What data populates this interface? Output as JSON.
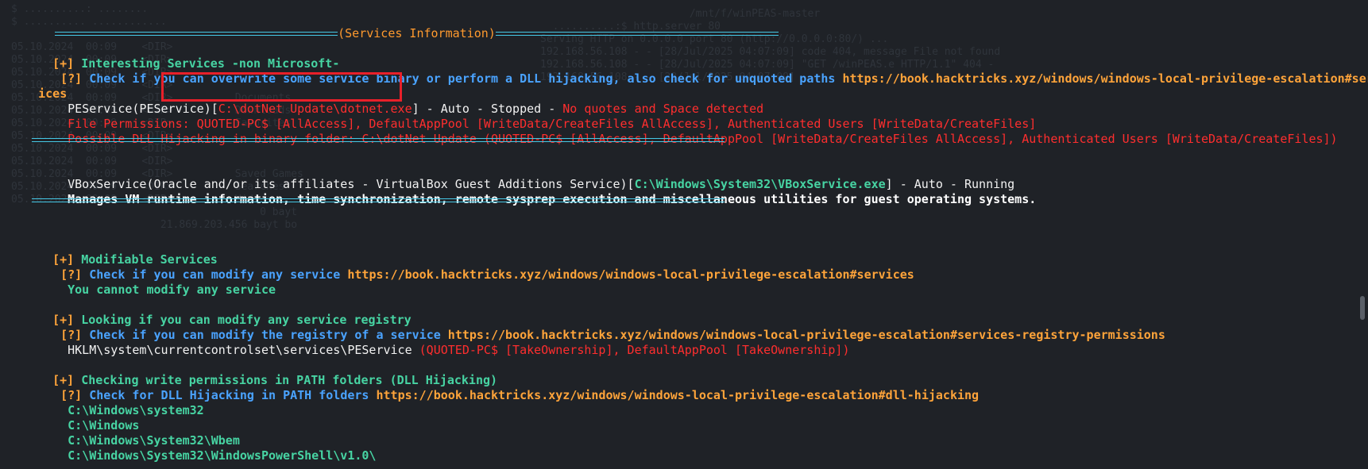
{
  "header": {
    "title": "(Services Information)"
  },
  "sections": {
    "interesting": {
      "heading_marker": "[+]",
      "heading": "Interesting Services -non Microsoft-",
      "check_marker": "[?]",
      "check_text": "Check if you can overwrite some service binary or perform a DLL hijacking, also check for unquoted paths",
      "check_url": "https://book.hacktricks.xyz/windows/windows-local-privilege-escalation#serv",
      "check_url_wrap": "ices",
      "pe_service": {
        "name": "PEService(PEService)[",
        "path": "C:\\dotNet Update\\dotnet.exe",
        "status": "] - Auto - Stopped - ",
        "warning": "No quotes and Space detected",
        "file_perms": "File Permissions: QUOTED-PC$ [AllAccess], DefaultAppPool [WriteData/CreateFiles AllAccess], Authenticated Users [WriteData/CreateFiles]",
        "dll_hijack": "Possible DLL Hijacking in binary folder: C:\\dotNet Update (QUOTED-PC$ [AllAccess], DefaultAppPool [WriteData/CreateFiles AllAccess], Authenticated Users [WriteData/CreateFiles])"
      },
      "vbox_service": {
        "name": "VBoxService(Oracle and/or its affiliates - VirtualBox Guest Additions Service)[",
        "path": "C:\\Windows\\System32\\VBoxService.exe",
        "status": "] - Auto - Running",
        "description": "Manages VM runtime information, time synchronization, remote sysprep execution and miscellaneous utilities for guest operating systems."
      }
    },
    "modifiable": {
      "heading_marker": "[+]",
      "heading": "Modifiable Services",
      "check_marker": "[?]",
      "check_text": "Check if you can modify any service",
      "check_url": "https://book.hacktricks.xyz/windows/windows-local-privilege-escalation#services",
      "result": "You cannot modify any service"
    },
    "registry": {
      "heading_marker": "[+]",
      "heading": "Looking if you can modify any service registry",
      "check_marker": "[?]",
      "check_text": "Check if you can modify the registry of a service",
      "check_url": "https://book.hacktricks.xyz/windows/windows-local-privilege-escalation#services-registry-permissions",
      "key": "HKLM\\system\\currentcontrolset\\services\\PEService",
      "perms": "(QUOTED-PC$ [TakeOwnership], DefaultAppPool [TakeOwnership])"
    },
    "path_folders": {
      "heading_marker": "[+]",
      "heading": "Checking write permissions in PATH folders (DLL Hijacking)",
      "check_marker": "[?]",
      "check_text": "Check for DLL Hijacking in PATH folders",
      "check_url": "https://book.hacktricks.xyz/windows/windows-local-privilege-escalation#dll-hijacking",
      "folders": [
        "C:\\Windows\\system32",
        "C:\\Windows",
        "C:\\Windows\\System32\\Wbem",
        "C:\\Windows\\System32\\WindowsPowerShell\\v1.0\\"
      ]
    }
  },
  "colors": {
    "background": "#1f2227",
    "heading_green": "#47d4a3",
    "check_blue": "#4aa3ff",
    "url_orange": "#ffa43a",
    "danger_red": "#ff2e2e",
    "separator_cyan": "#45c8e6",
    "highlight_box": "#e8202a"
  }
}
